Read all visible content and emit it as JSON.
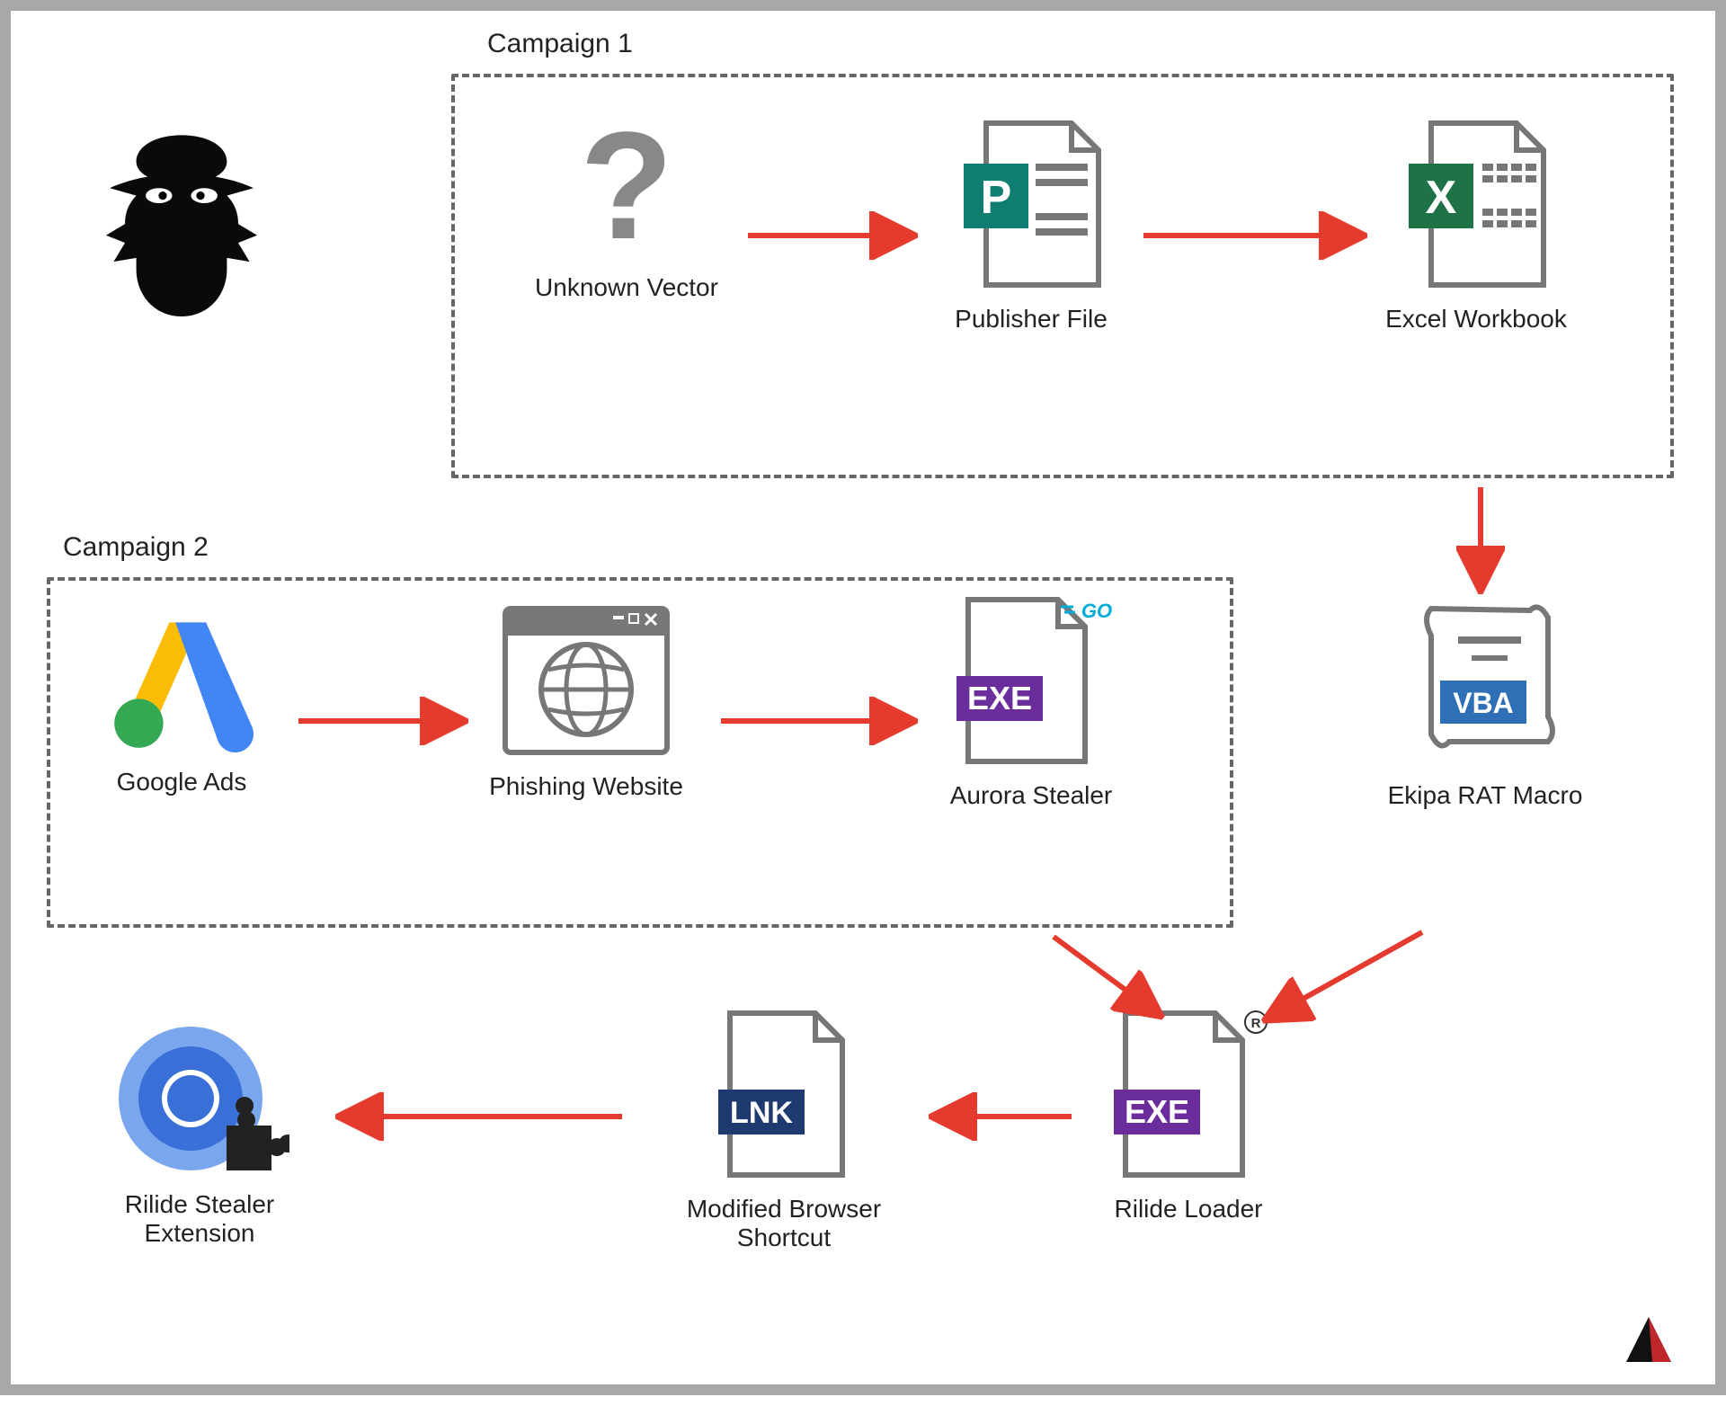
{
  "campaign1_title": "Campaign 1",
  "campaign2_title": "Campaign 2",
  "nodes": {
    "hacker": "",
    "unknown_vector": "Unknown Vector",
    "publisher_file": "Publisher File",
    "excel_workbook": "Excel Workbook",
    "google_ads": "Google Ads",
    "phishing_website": "Phishing Website",
    "aurora_stealer": "Aurora Stealer",
    "ekipa_rat_macro": "Ekipa RAT Macro",
    "rilide_extension": "Rilide Stealer Extension",
    "modified_shortcut": "Modified Browser Shortcut",
    "rilide_loader": "Rilide Loader"
  },
  "badges": {
    "exe": "EXE",
    "lnk": "LNK",
    "vba": "VBA",
    "p": "P",
    "x": "X",
    "go": "GO"
  },
  "colors": {
    "arrow": "#e43b2e",
    "dash": "#666666",
    "purple": "#6a2d9b",
    "navy": "#1f3a6e",
    "blue_vba": "#2f6fb5",
    "teal": "#0f7d6f",
    "green_x": "#1e7245",
    "go_blue": "#00ADD8",
    "chrome_blue": "#3a6fd8",
    "chrome_blue_light": "#7aa6ee",
    "google_blue": "#4285F4",
    "google_yellow": "#FBBC05",
    "google_green": "#34A853"
  }
}
